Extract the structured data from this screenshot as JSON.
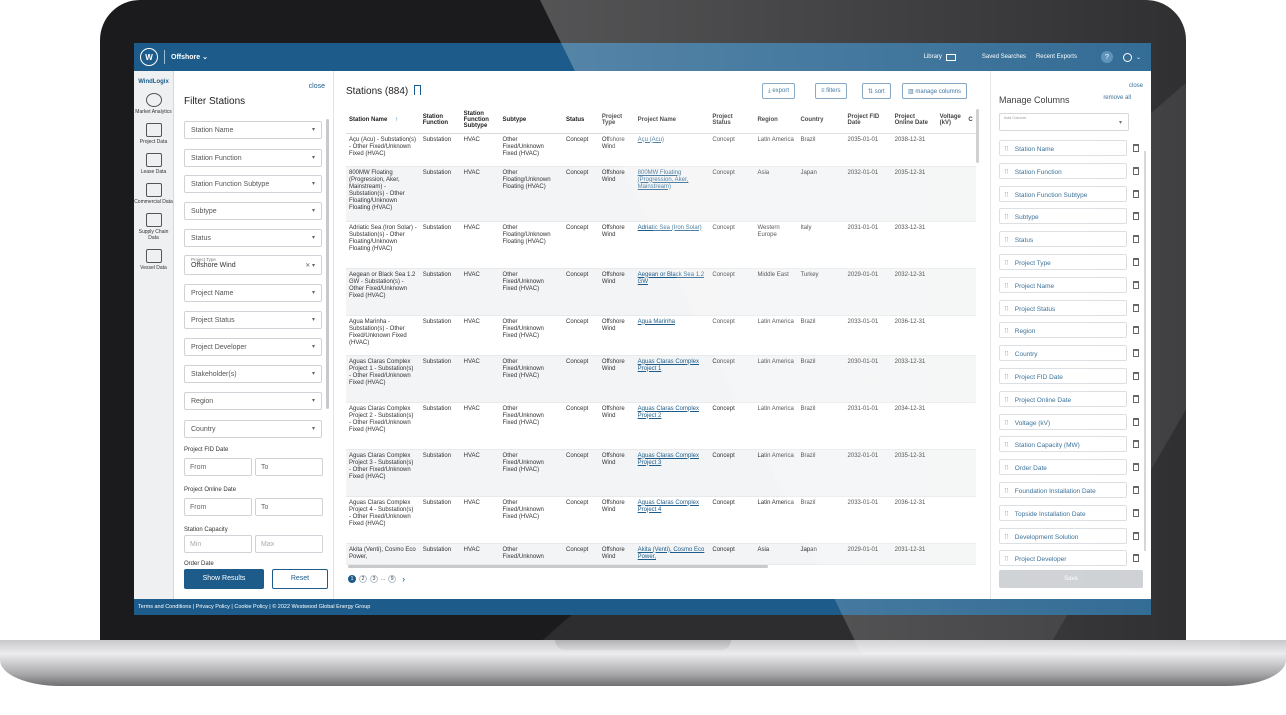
{
  "topbar": {
    "logo": "W",
    "product": "Offshore ⌄",
    "library": "Library",
    "saved_searches": "Saved Searches",
    "recent_exports": "Recent Exports",
    "help": "?",
    "user": "⌄"
  },
  "leftnav": {
    "brand": "WindLogix",
    "items": [
      "Market Analytics",
      "Project Data",
      "Lease Data",
      "Commercial Data",
      "Supply Chain Data",
      "Vessel Data"
    ]
  },
  "filter": {
    "title": "Filter Stations",
    "close": "close",
    "fields": [
      "Station Name",
      "Station Function",
      "Station Function Subtype",
      "Subtype",
      "Status"
    ],
    "project_type_label": "Project Type",
    "project_type_value": "Offshore Wind",
    "fields2": [
      "Project Name",
      "Project Status",
      "Project Developer",
      "Stakeholder(s)",
      "Region",
      "Country"
    ],
    "fid_label": "Project FID Date",
    "online_label": "Project Online Date",
    "capacity_label": "Station Capacity",
    "order_label": "Order Date",
    "from": "From",
    "to": "To",
    "min": "Min",
    "max": "Max",
    "show_results": "Show Results",
    "reset": "Reset"
  },
  "main": {
    "title": "Stations (884)",
    "export": "export",
    "filters": "filters",
    "sort": "sort",
    "manage_columns": "manage columns",
    "columns": [
      "Station Name",
      "Station Function",
      "Station Function Subtype",
      "Subtype",
      "Status",
      "Project Type",
      "Project Name",
      "Project Status",
      "Region",
      "Country",
      "Project FID Date",
      "Project Online Date",
      "Voltage (kV)",
      "C"
    ],
    "rows": [
      [
        "Açu (Acu) - Substation(s) - Other Fixed/Unknown Fixed (HVAC)",
        "Substation",
        "HVAC",
        "Other Fixed/Unknown Fixed (HVAC)",
        "Concept",
        "Offshore Wind",
        "Açu (Acu)",
        "Concept",
        "Latin America",
        "Brazil",
        "2035-01-01",
        "2038-12-31"
      ],
      [
        "800MW Floating (Progression, Aker, Mainstream) - Substation(s) - Other Floating/Unknown Floating (HVAC)",
        "Substation",
        "HVAC",
        "Other Floating/Unknown Floating (HVAC)",
        "Concept",
        "Offshore Wind",
        "800MW Floating (Progression, Aker, Mainstream)",
        "Concept",
        "Asia",
        "Japan",
        "2032-01-01",
        "2035-12-31"
      ],
      [
        "Adriatic Sea (Iron Solar) - Substation(s) - Other Floating/Unknown Floating (HVAC)",
        "Substation",
        "HVAC",
        "Other Floating/Unknown Floating (HVAC)",
        "Concept",
        "Offshore Wind",
        "Adriatic Sea (Iron Solar)",
        "Concept",
        "Western Europe",
        "Italy",
        "2031-01-01",
        "2033-12-31"
      ],
      [
        "Aegean or Black Sea 1.2 GW - Substation(s) - Other Fixed/Unknown Fixed (HVAC)",
        "Substation",
        "HVAC",
        "Other Fixed/Unknown Fixed (HVAC)",
        "Concept",
        "Offshore Wind",
        "Aegean or Black Sea 1.2 GW",
        "Concept",
        "Middle East",
        "Turkey",
        "2029-01-01",
        "2032-12-31"
      ],
      [
        "Agua Marinha - Substation(s) - Other Fixed/Unknown Fixed (HVAC)",
        "Substation",
        "HVAC",
        "Other Fixed/Unknown Fixed (HVAC)",
        "Concept",
        "Offshore Wind",
        "Agua Marinha",
        "Concept",
        "Latin America",
        "Brazil",
        "2033-01-01",
        "2036-12-31"
      ],
      [
        "Aguas Claras Complex Project 1 - Substation(s) - Other Fixed/Unknown Fixed (HVAC)",
        "Substation",
        "HVAC",
        "Other Fixed/Unknown Fixed (HVAC)",
        "Concept",
        "Offshore Wind",
        "Aguas Claras Complex Project 1",
        "Concept",
        "Latin America",
        "Brazil",
        "2030-01-01",
        "2033-12-31"
      ],
      [
        "Aguas Claras Complex Project 2 - Substation(s) - Other Fixed/Unknown Fixed (HVAC)",
        "Substation",
        "HVAC",
        "Other Fixed/Unknown Fixed (HVAC)",
        "Concept",
        "Offshore Wind",
        "Aguas Claras Complex Project 2",
        "Concept",
        "Latin America",
        "Brazil",
        "2031-01-01",
        "2034-12-31"
      ],
      [
        "Aguas Claras Complex Project 3 - Substation(s) - Other Fixed/Unknown Fixed (HVAC)",
        "Substation",
        "HVAC",
        "Other Fixed/Unknown Fixed (HVAC)",
        "Concept",
        "Offshore Wind",
        "Aguas Claras Complex Project 3",
        "Concept",
        "Latin America",
        "Brazil",
        "2032-01-01",
        "2035-12-31"
      ],
      [
        "Aguas Claras Complex Project 4 - Substation(s) - Other Fixed/Unknown Fixed (HVAC)",
        "Substation",
        "HVAC",
        "Other Fixed/Unknown Fixed (HVAC)",
        "Concept",
        "Offshore Wind",
        "Aguas Claras Complex Project 4",
        "Concept",
        "Latin America",
        "Brazil",
        "2033-01-01",
        "2036-12-31"
      ],
      [
        "Akita (Venti), Cosmo Eco Power,",
        "Substation",
        "HVAC",
        "Other Fixed/Unknown",
        "Concept",
        "Offshore Wind",
        "Akita (Venti), Cosmo Eco Power,",
        "Concept",
        "Asia",
        "Japan",
        "2029-01-01",
        "2031-12-31"
      ]
    ],
    "pages": [
      "1",
      "2",
      "3",
      "...",
      "9",
      "›"
    ]
  },
  "manage": {
    "title": "Manage Columns",
    "close": "close",
    "remove_all": "remove all",
    "add_label": "Add Column",
    "items": [
      "Station Name",
      "Station Function",
      "Station Function Subtype",
      "Subtype",
      "Status",
      "Project Type",
      "Project Name",
      "Project Status",
      "Region",
      "Country",
      "Project FID Date",
      "Project Online Date",
      "Voltage (kV)",
      "Station Capacity (MW)",
      "Order Date",
      "Foundation Installation Date",
      "Topside Installation Date",
      "Development Solution",
      "Project Developer"
    ],
    "save": "Save"
  },
  "footer": "Terms and Conditions  |  Privacy Policy  |  Cookie Policy  |  © 2022 Westwood Global Energy Group",
  "colors": {
    "primary": "#1d5c8a",
    "bezel": "#1b1b1d"
  }
}
